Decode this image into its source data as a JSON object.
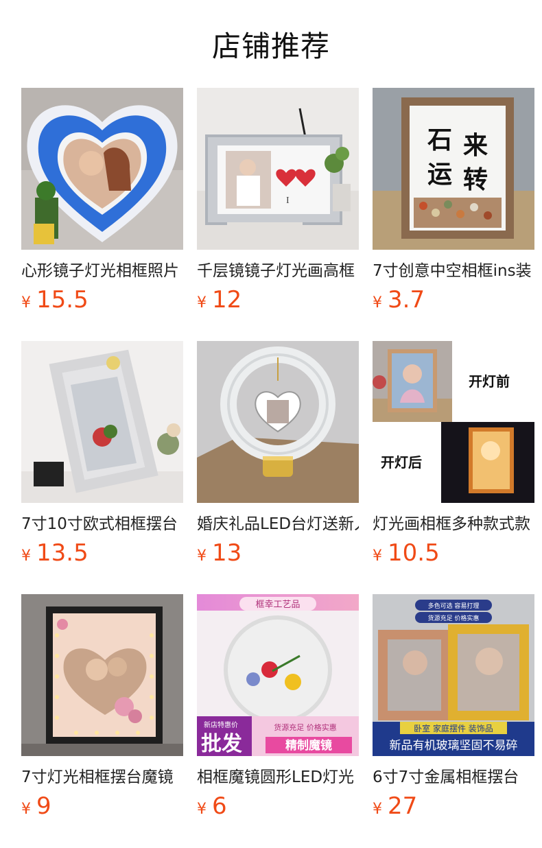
{
  "page": {
    "title": "店铺推荐"
  },
  "products": [
    {
      "name": "心形镜子灯光相框照片",
      "currency": "¥",
      "price": "15.5",
      "image_icon": "heart-frame-photo"
    },
    {
      "name": "千层镜镜子灯光画高框",
      "currency": "¥",
      "price": "12",
      "image_icon": "mirror-light-frame-photo"
    },
    {
      "name": "7寸创意中空相框ins装",
      "currency": "¥",
      "price": "3.7",
      "image_icon": "hollow-frame-photo",
      "image_text": [
        "石",
        "来",
        "运",
        "转"
      ]
    },
    {
      "name": "7寸10寸欧式相框摆台",
      "currency": "¥",
      "price": "13.5",
      "image_icon": "pearl-frame-photo"
    },
    {
      "name": "婚庆礼品LED台灯送新人",
      "currency": "¥",
      "price": "13",
      "image_icon": "led-ring-lamp-photo"
    },
    {
      "name": "灯光画相框多种款式款",
      "currency": "¥",
      "price": "10.5",
      "image_icon": "light-painting-frame-photo",
      "image_text": [
        "开灯前",
        "开灯后"
      ]
    },
    {
      "name": "7寸灯光相框摆台魔镜",
      "currency": "¥",
      "price": "9",
      "image_icon": "led-heart-frame-photo"
    },
    {
      "name": "相框魔镜圆形LED灯光",
      "currency": "¥",
      "price": "6",
      "image_icon": "round-magic-mirror-photo",
      "image_text": [
        "框幸工艺品",
        "新店特惠价",
        "批发",
        "货源充足 价格实惠",
        "精制魔镜"
      ]
    },
    {
      "name": "6寸7寸金属相框摆台",
      "currency": "¥",
      "price": "27",
      "image_icon": "metal-frame-photo",
      "image_text": [
        "多色可选 容易打理",
        "货源充足 价格实惠",
        "卧室 家庭摆件 装饰品",
        "新品有机玻璃坚固不易碎"
      ]
    }
  ]
}
